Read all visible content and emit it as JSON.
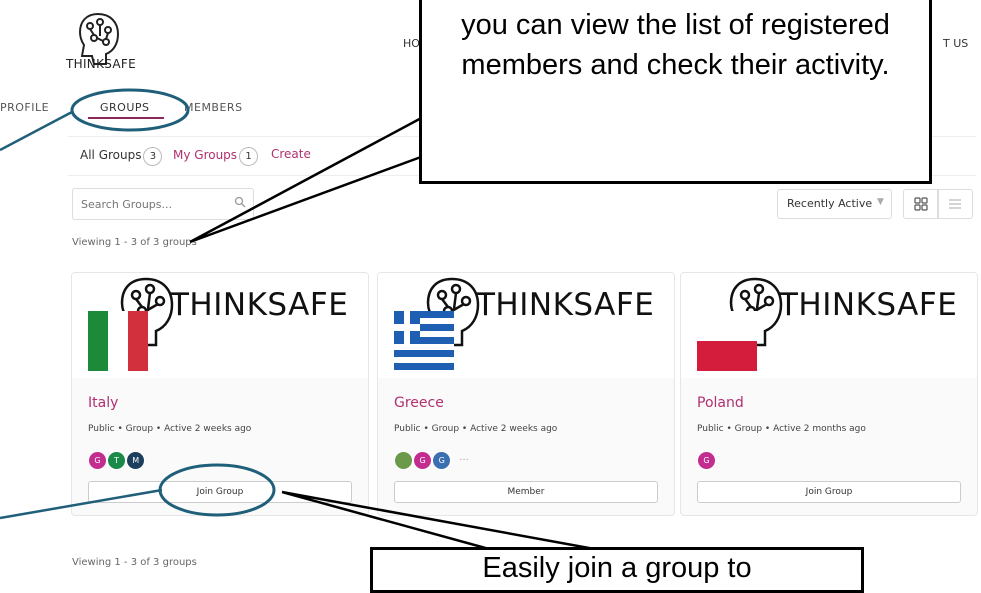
{
  "header": {
    "brand": "THINKSAFE",
    "nav_left_fragment": "HO",
    "nav_right_fragment": "T US"
  },
  "tabs": [
    {
      "label": "PROFILE"
    },
    {
      "label": "GROUPS"
    },
    {
      "label": "MEMBERS"
    }
  ],
  "filters": {
    "all_label": "All Groups",
    "all_count": "3",
    "my_label": "My Groups",
    "my_count": "1",
    "create_label": "Create"
  },
  "search": {
    "placeholder": "Search Groups..."
  },
  "sort": {
    "selected": "Recently Active"
  },
  "viewing_text": "Viewing 1 - 3 of 3 groups",
  "groups": [
    {
      "name": "Italy",
      "meta": "Public • Group • Active 2 weeks ago",
      "button": "Join Group",
      "banner_text": "THINKSAFE",
      "avatars": [
        "G",
        "T",
        "M"
      ]
    },
    {
      "name": "Greece",
      "meta": "Public • Group • Active 2 weeks ago",
      "button": "Member",
      "banner_text": "THINKSAFE",
      "avatars": [
        "",
        "G",
        "G"
      ],
      "more": "···"
    },
    {
      "name": "Poland",
      "meta": "Public • Group • Active 2 months ago",
      "button": "Join Group",
      "banner_text": "THINKSAFE",
      "avatars": [
        "G"
      ]
    }
  ],
  "callouts": {
    "top": "you can view the list of registered members and check their activity.",
    "bottom": "Easily join a group to"
  },
  "colors": {
    "accent": "#b03070",
    "highlight_circle": "#1f5f7a"
  }
}
